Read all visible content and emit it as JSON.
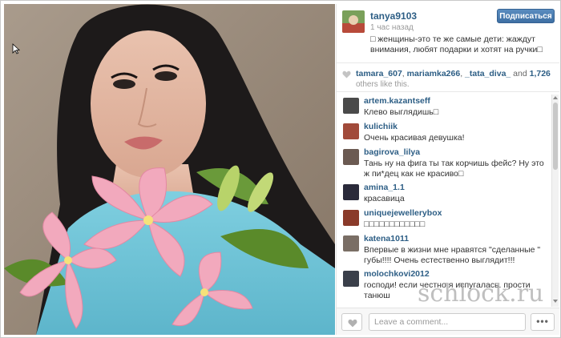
{
  "post": {
    "username": "tanya9103",
    "timestamp": "1 час назад",
    "follow_label": "Подписаться",
    "caption": "□ женщины-это те же самые дети: жаждут внимания, любят подарки и хотят на ручки□"
  },
  "likes": {
    "likers": [
      "tamara_607",
      "mariamka266",
      "_tata_diva_"
    ],
    "and_word": "and",
    "count": "1,726",
    "others_text": "others like this."
  },
  "comments": [
    {
      "user": "artem.kazantseff",
      "text": "Клево выглядишь□",
      "avatar_color": "#4a4a4a"
    },
    {
      "user": "kulichiik",
      "text": "Очень красивая девушка!",
      "avatar_color": "#a14a3a"
    },
    {
      "user": "bagirova_lilya",
      "text": "Тань ну на фига ты так корчишь фейс? Ну это ж пи*дец как не красиво□",
      "avatar_color": "#6b5a52"
    },
    {
      "user": "amina_1.1",
      "text": "красавица",
      "avatar_color": "#2a2a3a"
    },
    {
      "user": "uniquejewellerybox",
      "text": "□□□□□□□□□□□□",
      "avatar_color": "#8a3a2a"
    },
    {
      "user": "katena1011",
      "text": "Впервые в жизни мне нравятся \"сделанные \" губы!!!! Очень естественно выглядит!!!",
      "avatar_color": "#7a6e65"
    },
    {
      "user": "molochkovi2012",
      "text": "господи! если честно я испугалась. прости танюш",
      "avatar_color": "#3a3f4a"
    }
  ],
  "composer": {
    "placeholder": "Leave a comment...",
    "more_label": "•••"
  },
  "watermark": "schlock.ru",
  "colors": {
    "link_blue": "#2d5e85",
    "follow_button": "#3e6fa3"
  },
  "icons": {
    "heart": "heart-icon",
    "cursor": "cursor-arrow-icon"
  }
}
